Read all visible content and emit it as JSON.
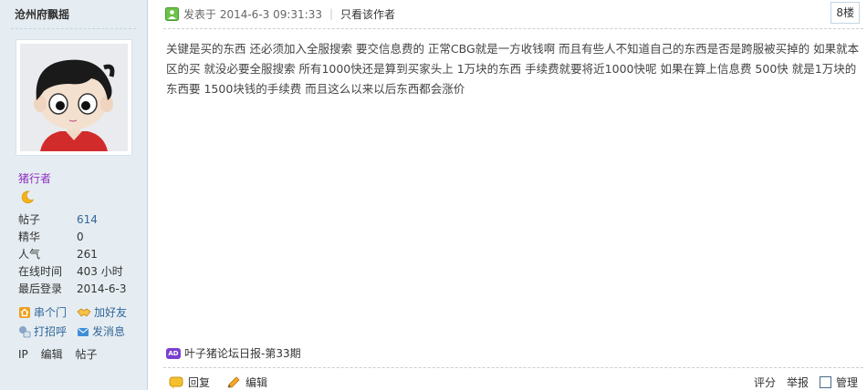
{
  "user": {
    "name": "沧州府飘摇",
    "rank": "猪行者",
    "stats": [
      {
        "label": "帖子",
        "value": "614",
        "link": true
      },
      {
        "label": "精华",
        "value": "0",
        "link": false
      },
      {
        "label": "人气",
        "value": "261",
        "link": false
      },
      {
        "label": "在线时间",
        "value": "403 小时",
        "link": false
      },
      {
        "label": "最后登录",
        "value": "2014-6-3",
        "link": false
      }
    ],
    "actions": [
      {
        "label": "串个门",
        "icon": "home-icon"
      },
      {
        "label": "加好友",
        "icon": "handshake-icon"
      },
      {
        "label": "打招呼",
        "icon": "greet-icon"
      },
      {
        "label": "发消息",
        "icon": "envelope-icon"
      }
    ],
    "admin_links": [
      "IP",
      "编辑",
      "帖子"
    ]
  },
  "post": {
    "posted_label": "发表于 2014-6-3 09:31:33",
    "author_only": "只看该作者",
    "floor": "8楼",
    "body": "关键是买的东西 还必须加入全服搜索 要交信息费的  正常CBG就是一方收钱啊 而且有些人不知道自己的东西是否是跨服被买掉的 如果就本区的买 就没必要全服搜索 所有1000快还是算到买家头上 1万块的东西 手续费就要将近1000快呢 如果在算上信息费 500快 就是1万块的东西要 1500块钱的手续费 而且这么以来以后东西都会涨价",
    "ad_badge": "AD",
    "ad_text": "叶子猪论坛日报-第33期"
  },
  "footer": {
    "reply": "回复",
    "edit": "编辑",
    "rate": "评分",
    "report": "举报",
    "manage": "管理"
  },
  "colors": {
    "sidebar_bg": "#e5edf2",
    "link": "#336699",
    "rank": "#8e2ec2"
  }
}
